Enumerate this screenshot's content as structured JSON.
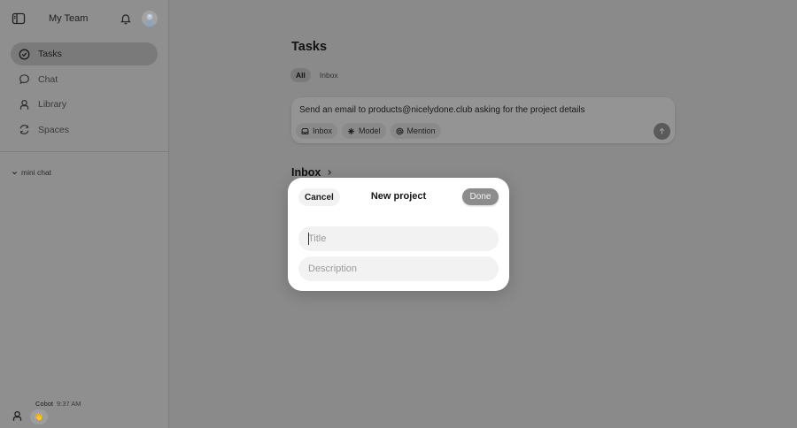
{
  "sidebar": {
    "team_name": "My Team",
    "nav": [
      {
        "label": "Tasks",
        "icon": "check-circle-icon",
        "active": true
      },
      {
        "label": "Chat",
        "icon": "chat-bubble-icon",
        "active": false
      },
      {
        "label": "Library",
        "icon": "person-icon",
        "active": false
      },
      {
        "label": "Spaces",
        "icon": "cycle-icon",
        "active": false
      }
    ],
    "mini_chat_label": "mini chat",
    "footer": {
      "sender": "Cobot",
      "time": "9:37 AM",
      "emoji": "👋"
    }
  },
  "main": {
    "title": "Tasks",
    "tabs": [
      {
        "label": "All",
        "active": true
      },
      {
        "label": "Inbox",
        "active": false
      }
    ],
    "composer": {
      "text": "Send an email to products@nicelydone.club asking for the project details",
      "chips": [
        "Inbox",
        "Model",
        "Mention"
      ]
    },
    "inbox_heading": "Inbox"
  },
  "modal": {
    "cancel_label": "Cancel",
    "title": "New project",
    "done_label": "Done",
    "title_placeholder": "Title",
    "description_placeholder": "Description"
  },
  "colors": {
    "overlay": "#8a8a8a",
    "modal_bg": "#ffffff",
    "field_bg": "#f2f2f2",
    "done_bg": "#8c8c8c"
  }
}
